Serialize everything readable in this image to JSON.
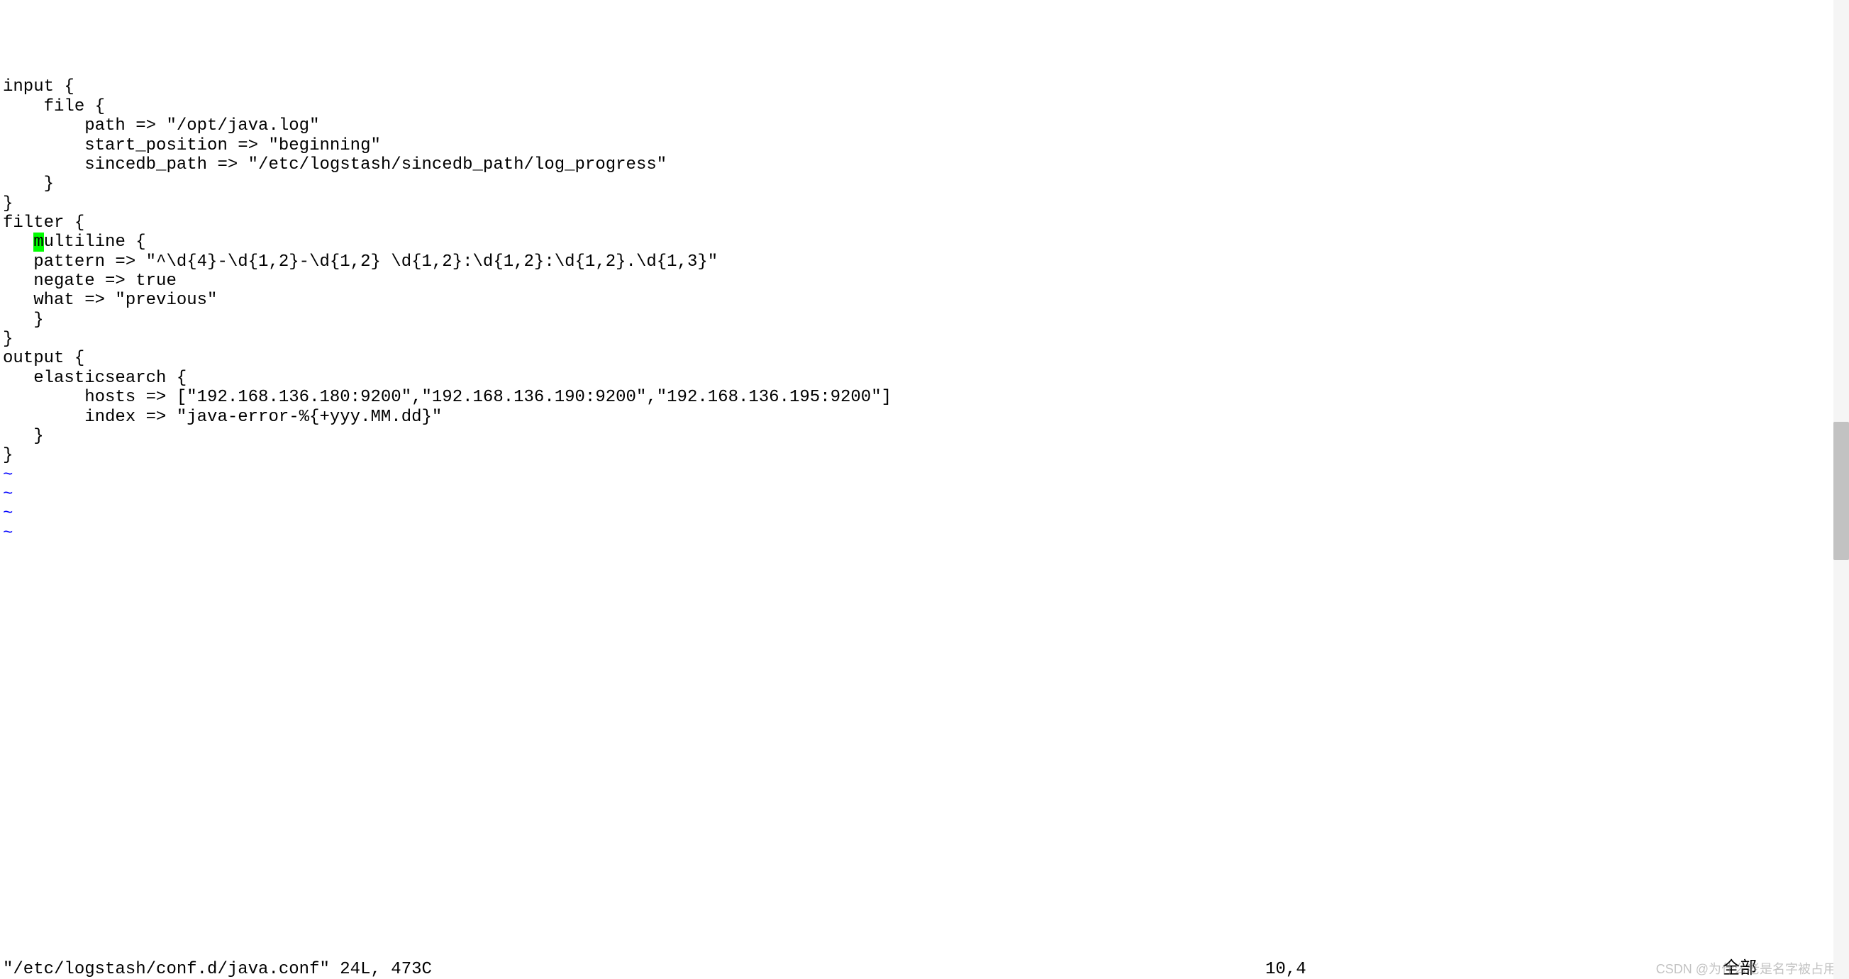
{
  "lines": [
    "input {",
    "    file {",
    "        path => \"/opt/java.log\"",
    "        start_position => \"beginning\"",
    "        sincedb_path => \"/etc/logstash/sincedb_path/log_progress\"",
    "    }",
    "}",
    "",
    "filter {"
  ],
  "cursor_line": {
    "prefix": "   ",
    "cursor_char": "m",
    "suffix": "ultiline {"
  },
  "lines_after": [
    "   pattern => \"^\\d{4}-\\d{1,2}-\\d{1,2} \\d{1,2}:\\d{1,2}:\\d{1,2}.\\d{1,3}\"",
    "   negate => true",
    "   what => \"previous\"",
    "   }",
    "",
    "}",
    "",
    "output {",
    "   elasticsearch {",
    "        hosts => [\"192.168.136.180:9200\",\"192.168.136.190:9200\",\"192.168.136.195:9200\"]",
    "        index => \"java-error-%{+yyy.MM.dd}\"",
    "   }",
    "}",
    ""
  ],
  "tildes": [
    "~",
    "~",
    "~",
    "~"
  ],
  "status": {
    "file_info": "\"/etc/logstash/conf.d/java.conf\" 24L, 473C",
    "position": "10,4",
    "mode": "全部"
  },
  "watermark": "CSDN @为什么老是名字被占用"
}
